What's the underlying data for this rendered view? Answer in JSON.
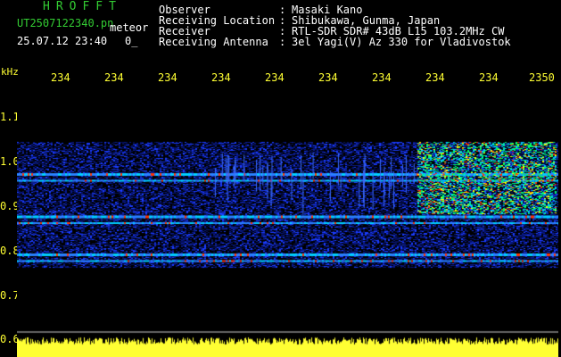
{
  "header": {
    "title": "HROFFT",
    "filename": "UT2507122340.pn",
    "filename_suffix": "meteor",
    "datetime": "25.07.12 23:40",
    "counter": "0_",
    "fields": [
      {
        "label": "Observer",
        "value": "Masaki Kano"
      },
      {
        "label": "Receiving Location",
        "value": "Shibukawa, Gunma, Japan"
      },
      {
        "label": "Receiver",
        "value": "RTL-SDR SDR# 43dB L15 103.2MHz CW"
      },
      {
        "label": "Receiving Antenna",
        "value": "3el Yagi(V) Az 330 for Vladivostok"
      }
    ],
    "colon": ":"
  },
  "colors": {
    "title": "#33cc33",
    "text": "#ffffff",
    "axis": "#ffff33",
    "background": "#000000",
    "noise_floor": "#0a1a8c",
    "band": "#00d0ff",
    "hot": "#ff3300"
  },
  "chart_data": {
    "type": "heatmap",
    "xlabel": "",
    "ylabel": "kHz",
    "x_tick_labels": [
      "234",
      "234",
      "234",
      "234",
      "234",
      "234",
      "234",
      "234",
      "234",
      "2350"
    ],
    "y_tick_labels": [
      "1.1",
      "1.0",
      "0.9",
      "0.8",
      "0.7",
      "0.6"
    ],
    "y_ticks": [
      1.1,
      1.0,
      0.9,
      0.8,
      0.7,
      0.6
    ],
    "ylim": [
      0.6,
      1.1
    ],
    "time_minutes": [
      2340,
      2350
    ],
    "signal_band_khz": [
      0.76,
      1.04
    ],
    "strong_lines_khz": [
      0.97,
      0.955,
      0.875,
      0.86,
      0.79,
      0.775
    ],
    "meteor_activity_region": {
      "minutes": [
        2347.7,
        2350
      ],
      "khz": [
        0.88,
        1.04
      ]
    },
    "grid": false
  }
}
